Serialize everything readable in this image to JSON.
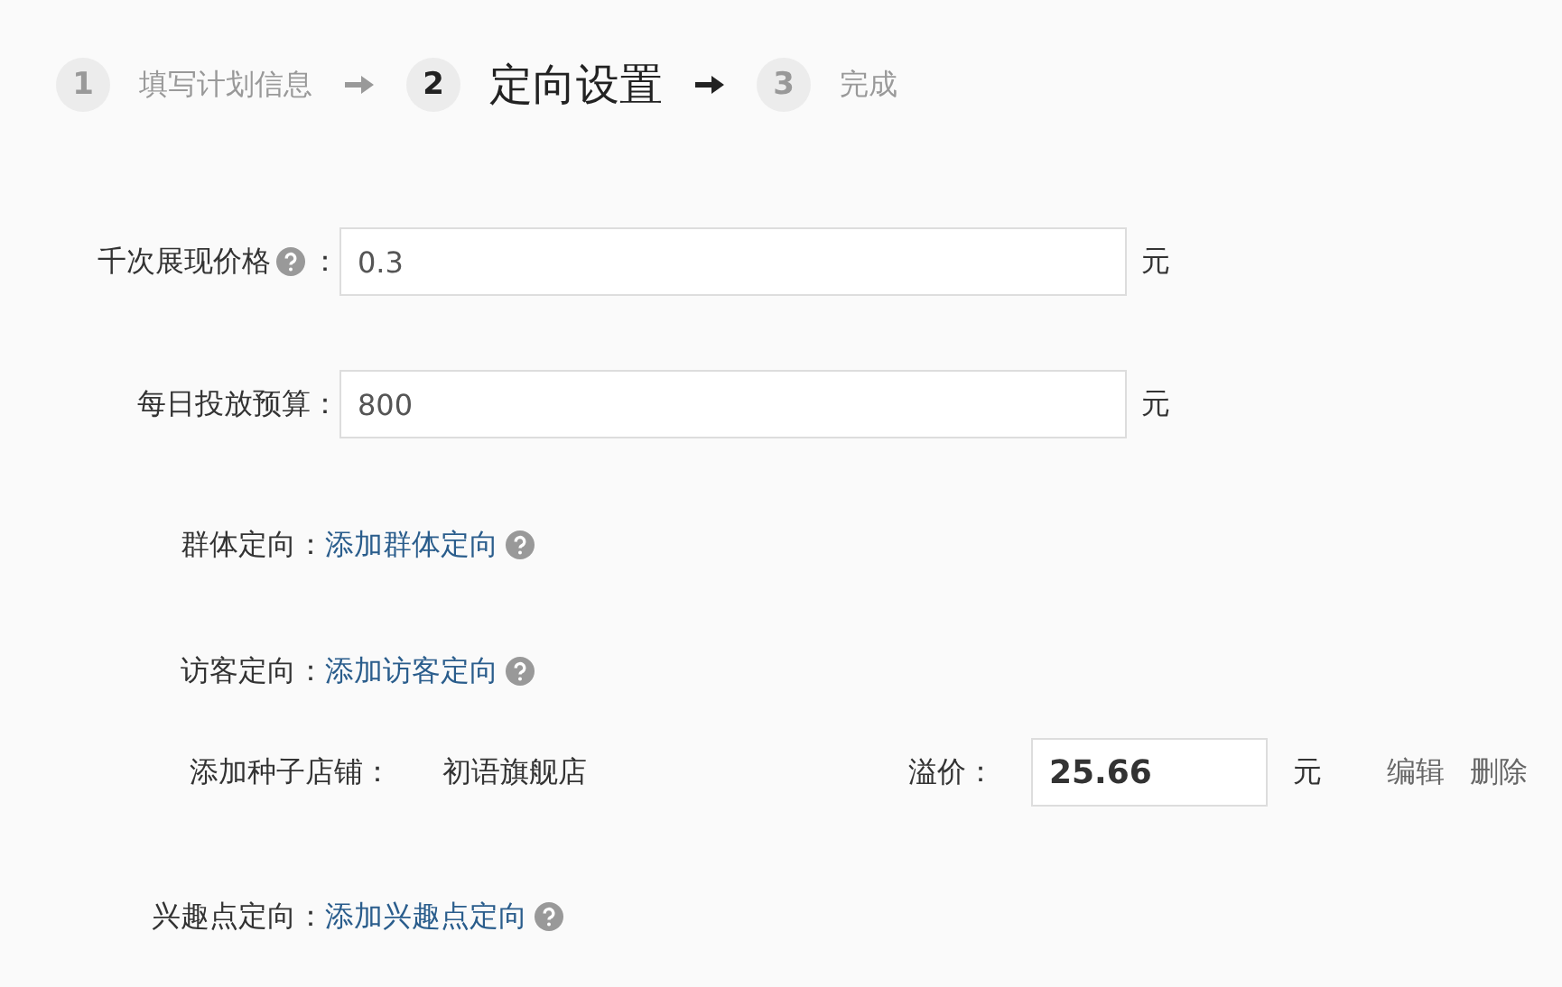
{
  "steps": [
    {
      "number": "1",
      "label": "填写计划信息",
      "selected": false
    },
    {
      "number": "2",
      "label": "定向设置",
      "selected": true
    },
    {
      "number": "3",
      "label": "完成",
      "selected": false
    }
  ],
  "fields": [
    {
      "label": "千次展现价格",
      "help": true,
      "colon": "：",
      "value": "0.3",
      "unit": "元"
    },
    {
      "label": "每日投放预算：",
      "help": false,
      "value": "800",
      "unit": "元"
    }
  ],
  "targeting": [
    {
      "label": "群体定向：",
      "link": "添加群体定向",
      "help": true
    },
    {
      "label": "访客定向：",
      "link": "添加访客定向",
      "help": true,
      "seed_shop": {
        "label": "添加种子店铺：",
        "shop": "初语旗舰店",
        "premium_label": "溢价：",
        "premium_value": "25.66",
        "unit": "元",
        "actions": [
          "编辑",
          "删除"
        ]
      }
    },
    {
      "label": "兴趣点定向：",
      "link": "添加兴趣点定向",
      "help": true
    }
  ]
}
